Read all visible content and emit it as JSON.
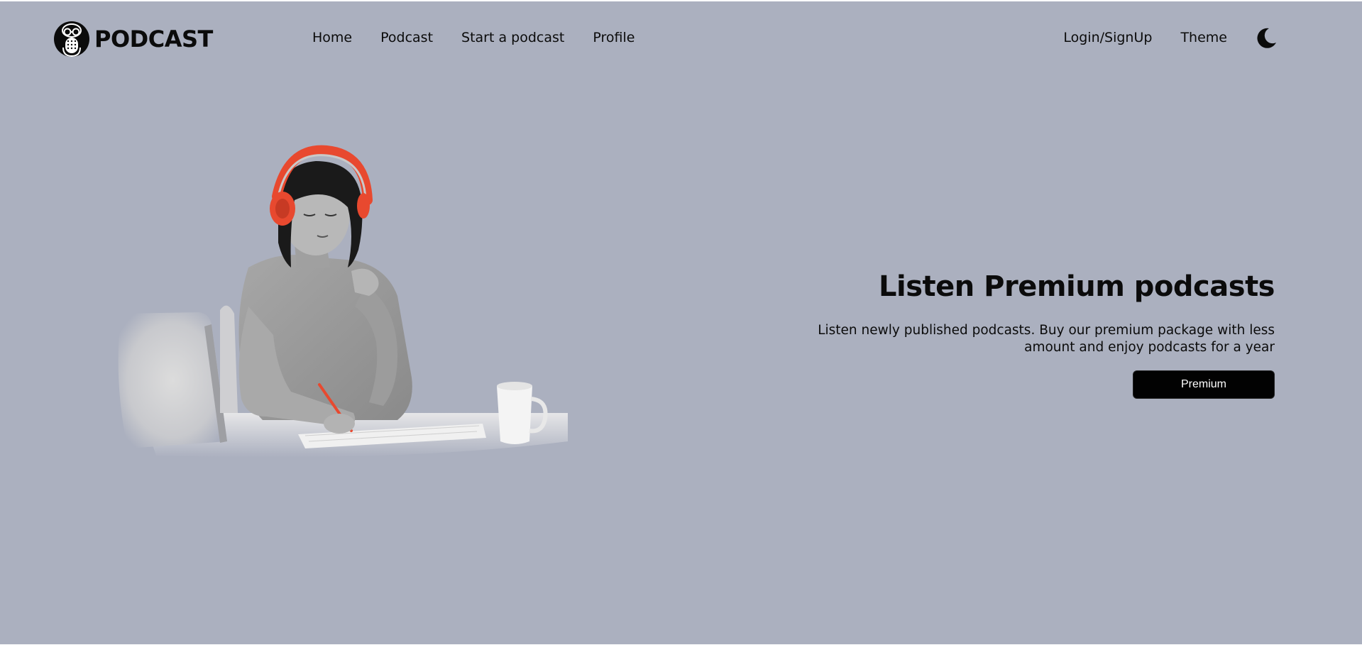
{
  "header": {
    "logo_text": "PODCAST",
    "logo_icon": "microphone-face-icon",
    "nav": {
      "home": "Home",
      "podcast": "Podcast",
      "start_podcast": "Start a podcast",
      "profile": "Profile"
    },
    "login": "Login/SignUp",
    "theme": "Theme",
    "theme_icon": "moon-icon"
  },
  "hero": {
    "title": "Listen Premium podcasts",
    "description_line1": "Listen newly published podcasts. Buy our premium package with less",
    "description_line2": "amount and enjoy podcasts for a year",
    "button_label": "Premium"
  },
  "colors": {
    "background": "#abb0bf",
    "text": "#0b0b0b",
    "button_bg": "#020202",
    "button_text": "#ffffff",
    "headphones": "#e8492f"
  }
}
